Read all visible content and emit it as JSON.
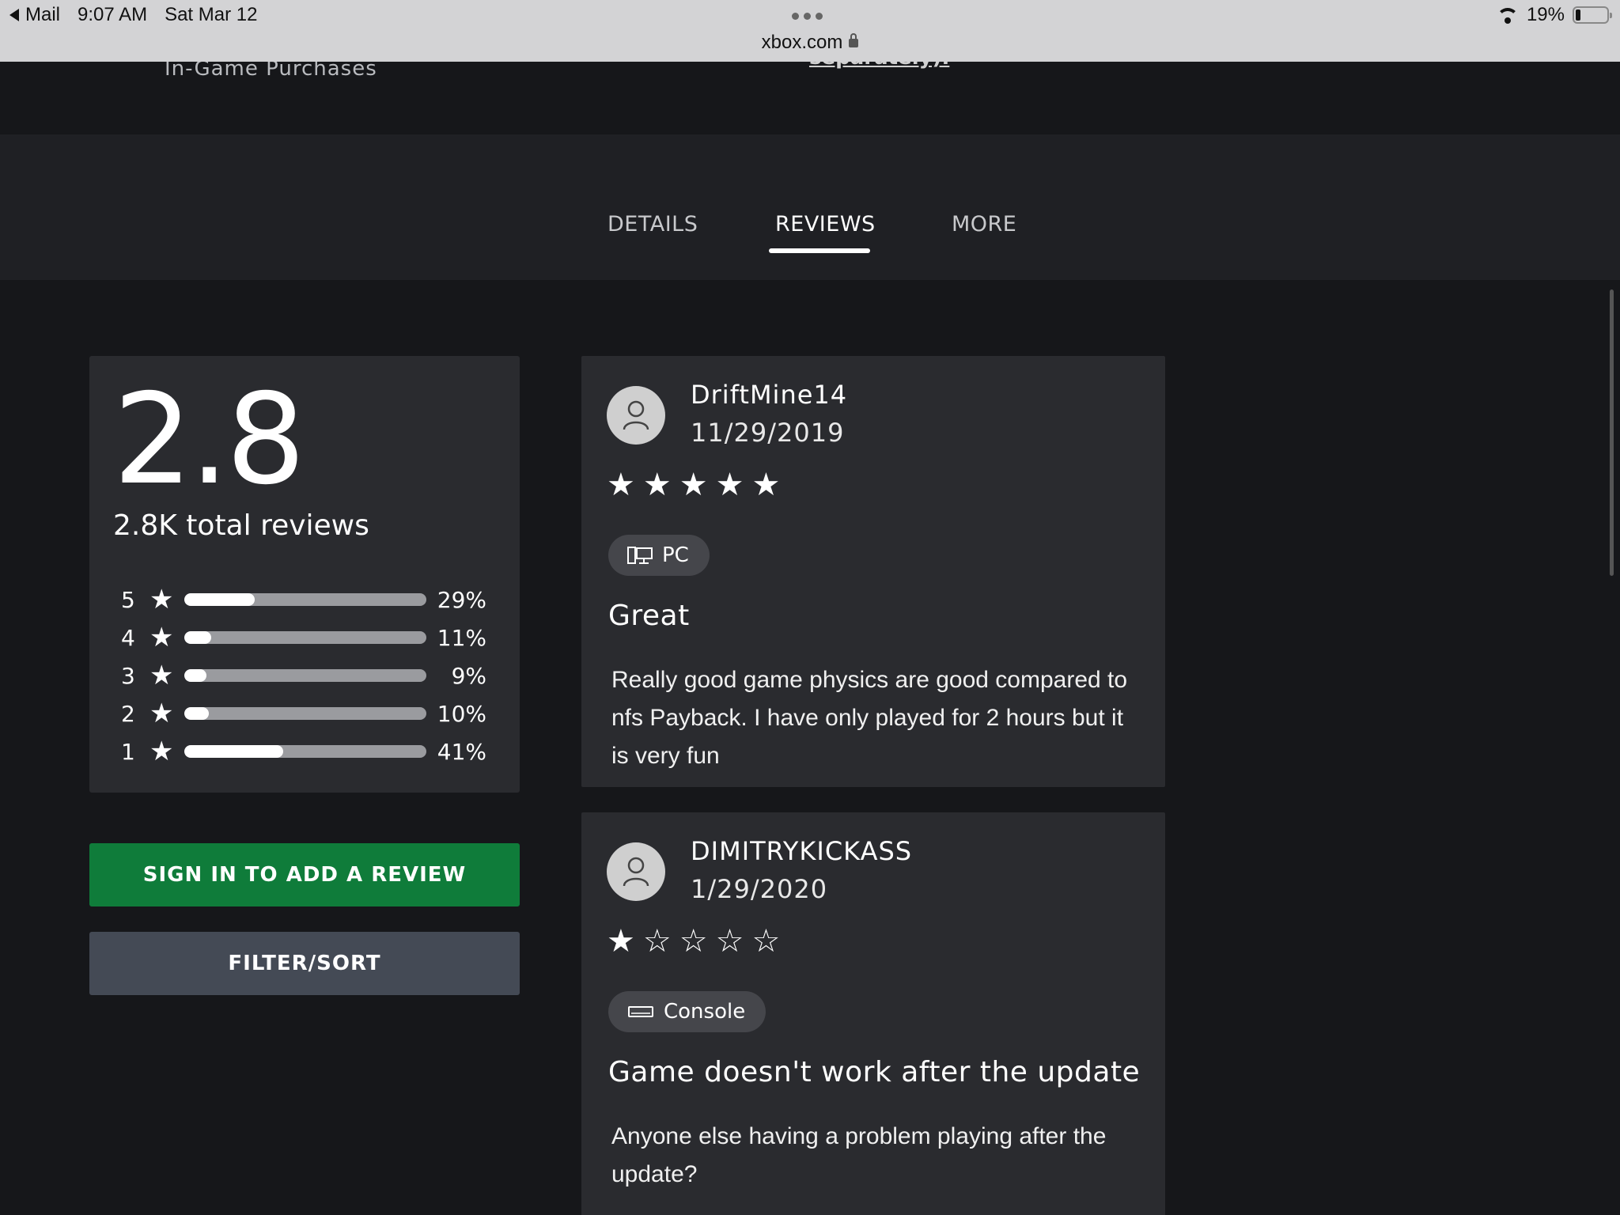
{
  "status_bar": {
    "back_label": "Mail",
    "time": "9:07 AM",
    "date": "Sat Mar 12",
    "url": "xbox.com",
    "battery": "19%",
    "battery_level": 0.19
  },
  "top_strip": {
    "left_text": "In-Game Purchases",
    "right_link": "separately)."
  },
  "tabs": [
    {
      "label": "DETAILS",
      "active": false
    },
    {
      "label": "REVIEWS",
      "active": true
    },
    {
      "label": "MORE",
      "active": false
    }
  ],
  "summary": {
    "rating": "2.8",
    "total_reviews": "2.8K total reviews",
    "histogram": [
      {
        "stars": "5",
        "percent_label": "29%",
        "percent": 29
      },
      {
        "stars": "4",
        "percent_label": "11%",
        "percent": 11
      },
      {
        "stars": "3",
        "percent_label": "9%",
        "percent": 9
      },
      {
        "stars": "2",
        "percent_label": "10%",
        "percent": 10
      },
      {
        "stars": "1",
        "percent_label": "41%",
        "percent": 41
      }
    ]
  },
  "buttons": {
    "sign_in": "SIGN IN TO ADD A REVIEW",
    "filter": "FILTER/SORT"
  },
  "reviews": [
    {
      "user": "DriftMine14",
      "date": "11/29/2019",
      "rating": 5,
      "stars": "★★★★★",
      "platform": "PC",
      "platform_icon": "pc-icon",
      "title": "Great",
      "body": "Really good game physics are good compared to nfs Payback. I have only played for 2 hours but it is very fun"
    },
    {
      "user": "DIMITRYKICKASS",
      "date": "1/29/2020",
      "rating": 1,
      "stars": "★☆☆☆☆",
      "platform": "Console",
      "platform_icon": "console-icon",
      "title": "Game doesn't work after the update",
      "body": "Anyone else having a problem playing after the update?"
    }
  ],
  "colors": {
    "background": "#16171a",
    "card": "#2a2b2f",
    "accent_green": "#0f7c3a",
    "filter_button": "#444a55"
  }
}
